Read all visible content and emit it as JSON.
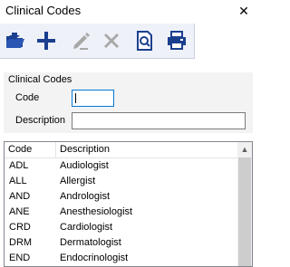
{
  "window": {
    "title": "Clinical Codes",
    "close_glyph": "✕"
  },
  "toolbar": {
    "buttons": [
      {
        "name": "open-folder-icon",
        "enabled": true
      },
      {
        "name": "add-icon",
        "enabled": true
      },
      {
        "name": "edit-icon",
        "enabled": false
      },
      {
        "name": "delete-icon",
        "enabled": false
      },
      {
        "name": "preview-icon",
        "enabled": true
      },
      {
        "name": "print-icon",
        "enabled": true
      }
    ]
  },
  "filter": {
    "group_label": "Clinical Codes",
    "code_label": "Code",
    "code_value": "",
    "description_label": "Description",
    "description_value": ""
  },
  "table": {
    "columns": [
      "Code",
      "Description"
    ],
    "rows": [
      [
        "ADL",
        "Audiologist"
      ],
      [
        "ALL",
        "Allergist"
      ],
      [
        "AND",
        "Andrologist"
      ],
      [
        "ANE",
        "Anesthesiologist"
      ],
      [
        "CRD",
        "Cardiologist"
      ],
      [
        "DRM",
        "Dermatologist"
      ],
      [
        "END",
        "Endocrinologist"
      ]
    ],
    "scroll_up_glyph": "▲"
  },
  "colors": {
    "toolbar_bg": "#eef1f8",
    "icon_blue": "#1b3f8f",
    "icon_disabled": "#a8a8a8",
    "focus_border": "#0078d7"
  }
}
